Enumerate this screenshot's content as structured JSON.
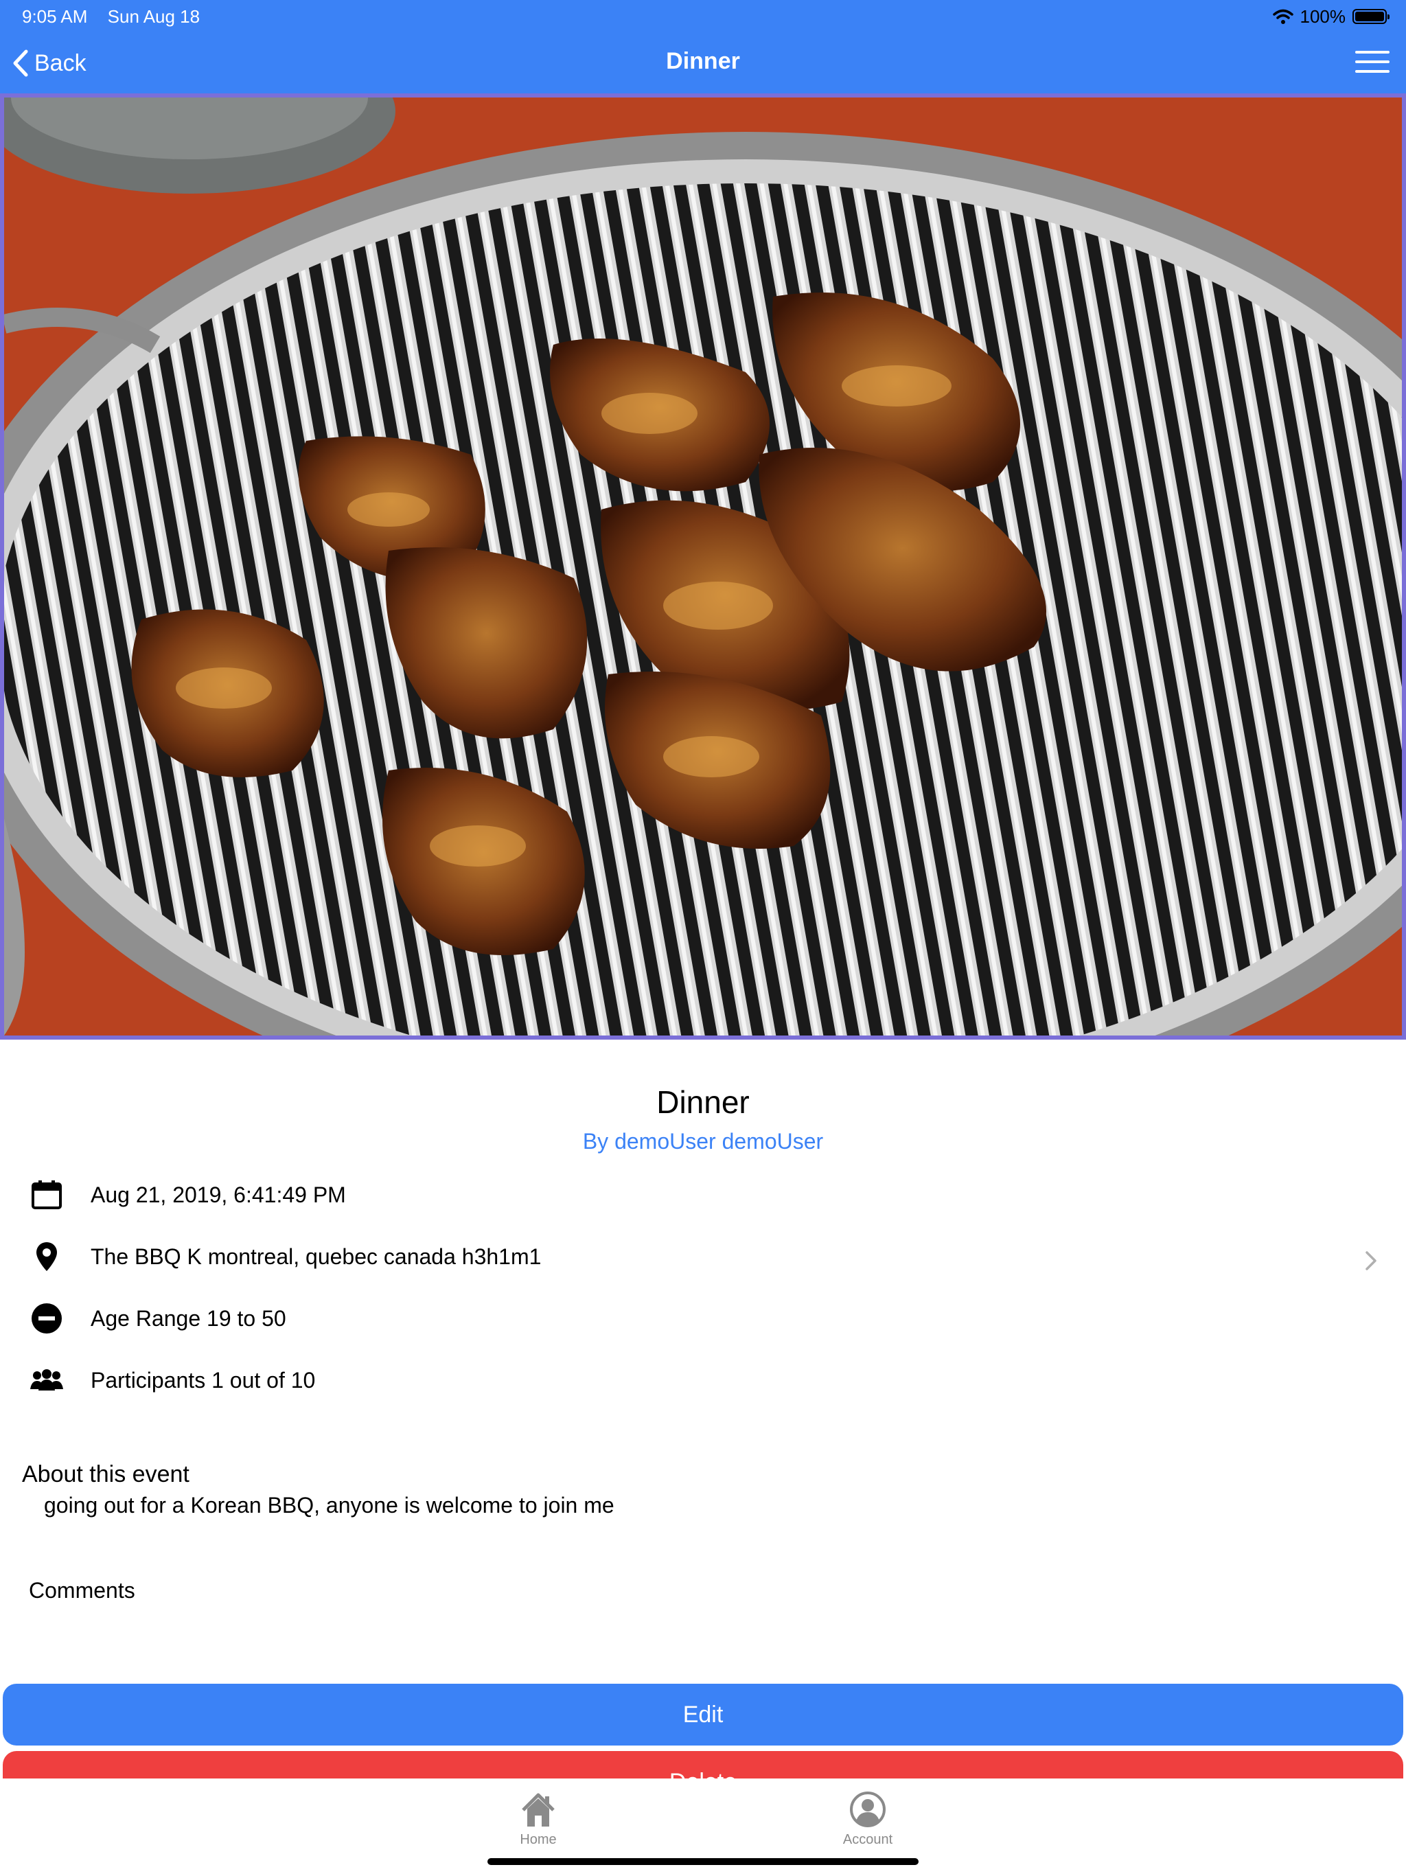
{
  "status_bar": {
    "time": "9:05 AM",
    "date": "Sun Aug 18",
    "battery": "100%"
  },
  "nav": {
    "back_label": "Back",
    "title": "Dinner"
  },
  "event": {
    "title": "Dinner",
    "author": "By demoUser demoUser",
    "datetime": "Aug 21, 2019, 6:41:49 PM",
    "location": "The BBQ K montreal, quebec canada h3h1m1",
    "age_range": "Age Range 19 to 50",
    "participants": "Participants 1 out of 10",
    "about_heading": "About this event",
    "about_text": "going out for a Korean BBQ, anyone is welcome to join me",
    "comments_heading": "Comments"
  },
  "buttons": {
    "edit": "Edit",
    "delete": "Delete"
  },
  "tabs": [
    {
      "label": "Home",
      "icon": "home-icon"
    },
    {
      "label": "Account",
      "icon": "account-icon"
    }
  ],
  "colors": {
    "accent": "#3b82f6",
    "danger": "#ef3f3f"
  }
}
